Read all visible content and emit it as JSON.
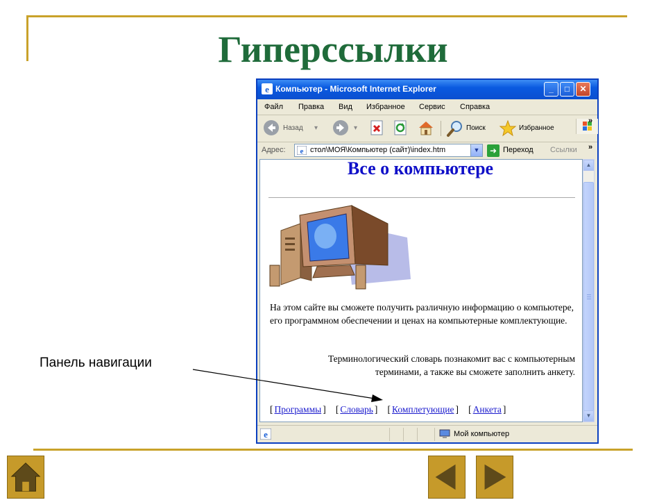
{
  "slide": {
    "title": "Гиперссылки",
    "nav_label": "Панель навигации",
    "colors": {
      "rule": "#c9a22a",
      "title": "#1f6b3a",
      "button": "#c69a2a"
    }
  },
  "window": {
    "title": "Компьютер - Microsoft Internet Explorer",
    "menu": [
      "Файл",
      "Правка",
      "Вид",
      "Избранное",
      "Сервис",
      "Справка"
    ],
    "toolbar": {
      "back": "Назад",
      "search": "Поиск",
      "favorites": "Избранное"
    },
    "address": {
      "label": "Адрес:",
      "value": "стол\\МОЯ\\Компьютер (сайт)\\index.htm",
      "go": "Переход",
      "links": "Ссылки"
    },
    "status": {
      "zone": "Мой компьютер"
    }
  },
  "page": {
    "heading": "Все о компьютере",
    "paragraph1": "На этом сайте вы сможете получить различную информацию о компьютере, его программном обеспечении и ценах на компьютерные комплектующие.",
    "paragraph2": "Терминологический словарь познакомит вас с компьютерным терминами, а также вы сможете заполнить анкету.",
    "nav": [
      "Программы",
      "Словарь",
      "Комплетующие",
      "Анкета"
    ]
  }
}
